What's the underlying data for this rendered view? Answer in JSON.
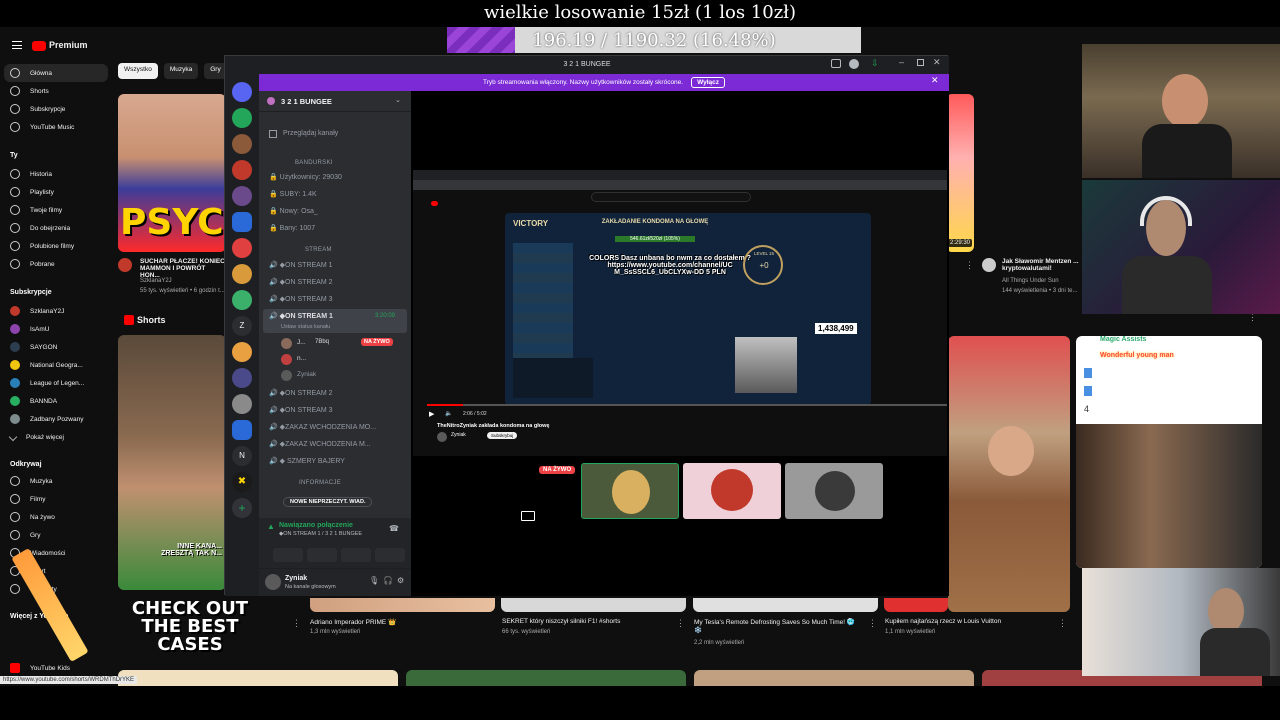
{
  "overlay": {
    "title": "wielkie losowanie 15zł (1 los 10zł)",
    "progress_text": "196.19 / 1190.32 (16.48%)",
    "progress_fraction": 0.1648
  },
  "youtube": {
    "logo_text": "Premium",
    "sidebar": {
      "main": [
        {
          "label": "Główna",
          "icon": "home-icon"
        },
        {
          "label": "Shorts",
          "icon": "shorts-icon"
        },
        {
          "label": "Subskrypcje",
          "icon": "subscriptions-icon"
        },
        {
          "label": "YouTube Music",
          "icon": "music-icon"
        }
      ],
      "you_heading": "Ty",
      "you": [
        {
          "label": "Historia",
          "icon": "history-icon"
        },
        {
          "label": "Playlisty",
          "icon": "playlist-icon"
        },
        {
          "label": "Twoje filmy",
          "icon": "video-icon"
        },
        {
          "label": "Do obejrzenia",
          "icon": "clock-icon"
        },
        {
          "label": "Polubione filmy",
          "icon": "thumbs-up-icon"
        },
        {
          "label": "Pobrane",
          "icon": "download-icon"
        }
      ],
      "subs_heading": "Subskrypcje",
      "subs": [
        {
          "label": "SzklanaY2J",
          "color": "#c0392b"
        },
        {
          "label": "IsAmU",
          "color": "#8e44ad"
        },
        {
          "label": "SAYGON",
          "color": "#2c3e50"
        },
        {
          "label": "National Geogra...",
          "color": "#f1c40f"
        },
        {
          "label": "League of Legen...",
          "color": "#2980b9"
        },
        {
          "label": "BANNDA",
          "color": "#27ae60"
        },
        {
          "label": "Zadbany Pozwany",
          "color": "#7f8c8d"
        },
        {
          "label": "Pokaż więcej",
          "color": "#0f0f0f"
        }
      ],
      "explore_heading": "Odkrywaj",
      "explore": [
        {
          "label": "Muzyka",
          "icon": "music-note-icon"
        },
        {
          "label": "Filmy",
          "icon": "film-icon"
        },
        {
          "label": "Na żywo",
          "icon": "live-icon"
        },
        {
          "label": "Gry",
          "icon": "gamepad-icon"
        },
        {
          "label": "Wiadomości",
          "icon": "news-icon"
        },
        {
          "label": "Sport",
          "icon": "trophy-icon"
        },
        {
          "label": "Podcasty",
          "icon": "podcast-icon"
        }
      ],
      "more_heading": "Więcej z YouTube",
      "kids": "YouTube Kids"
    },
    "chips": [
      "Wszystko",
      "Muzyka",
      "Gry"
    ],
    "videos_top": [
      {
        "title": "SUCHAR PŁACZE! KONIEC MAMMON I POWRÓT HON...",
        "channel": "SzklanaY2J",
        "meta": "55 tys. wyświetleń • 6 godzin t..."
      },
      {
        "title": "Jak Sławomir Mentzen ... kryptowalutami!",
        "channel": "All Things Under Sun",
        "meta": "144 wyświetlenia • 3 dni te..."
      }
    ],
    "thumb_text": "PSYCH",
    "thumb_duration": "2:29:30",
    "shorts_heading": "Shorts",
    "shorts_overlay": "INNE KANA... ZRESZTĄ TAK N...",
    "case_promo": "CHECK OUT THE BEST CASES",
    "shorts_bottom": [
      {
        "title": "Adriano Imperador PRIME 👑",
        "meta": "1,3 mln wyświetleń"
      },
      {
        "title": "SEKRET który niszczył silniki F1! #shorts",
        "meta": "66 tys. wyświetleń"
      },
      {
        "title": "My Tesla's Remote Defrosting Saves So Much Time! 🥶 ❄️",
        "meta": "2,2 mln wyświetleń"
      },
      {
        "title": "Kupiłem najtańszą rzecz w Louis Vuitton",
        "meta": "1,1 mln wyświetleń"
      }
    ],
    "chat_lines": [
      "Magic Assists",
      "Wonderful young man",
      "4"
    ],
    "status_url": "https://www.youtube.com/shorts/WRDMThDrYKE"
  },
  "discord": {
    "window_title": "3 2 1 BUNGEE",
    "banner_text": "Tryb streamowania włączony. Nazwy użytkowników zostały skrócone.",
    "banner_button": "Wyłącz",
    "server_name": "3 2 1 BUNGEE",
    "browse_channels": "Przeglądaj kanały",
    "categories": {
      "bandurski": "BANDURSKI",
      "stream": "STREAM",
      "informacje": "INFORMACJE"
    },
    "stats": [
      "Użytkownicy: 29030",
      "SUBY: 1.4K",
      "Nowy: Osa_",
      "Bany: 1007"
    ],
    "voice_channels": [
      "◆ON STREAM 1",
      "◆ON STREAM 2",
      "◆ON STREAM 3"
    ],
    "active_channel": {
      "name": "◆ON STREAM 1",
      "timer": "3:20:09",
      "status": "Ustaw status kanału",
      "members": [
        "J...",
        "n...",
        "Zyniak"
      ],
      "member_badge": "7Bbq",
      "live_badge": "NA ŻYWO"
    },
    "voice_channels_more": [
      "◆ON STREAM 2",
      "◆ON STREAM 3",
      "◆ZAKAZ WCHODZENIA MO...",
      "◆ZAKAZ WCHODZENIA M...",
      "◆ SZMERY BAJERY"
    ],
    "new_unread": "NOWE NIEPRZECZYT. WIAD.",
    "voice_panel": {
      "connected": "Nawiązano połączenie",
      "channel": "◆ON STREAM 1 / 3 2 1 BUNGEE"
    },
    "user": {
      "name": "Zyniak",
      "status": "Na kanale głosowym"
    },
    "stage": {
      "live_badge": "NA ŻYWO",
      "share_title": "TheNitroZyniak zakłada kondoma na głowę",
      "share_channel": "Zyniak",
      "share_subscribe": "Subskrybuj",
      "share_time": "2:06 / 5:02",
      "lol": {
        "result": "VICTORY",
        "headline": "ZAKŁADANIE KONDOMA NA GŁOWĘ",
        "progress": "546.61zł/520zł (105%)",
        "donation": "COLORS Dasz unbana bo nwm za co dostałem ? https://www.youtube.com/channel/UC M_SsSSCL6_UbCLYXw-DD 5 PLN",
        "counter": "1,438,499",
        "level": "LEVEL 15",
        "level_plus": "+0"
      }
    }
  }
}
